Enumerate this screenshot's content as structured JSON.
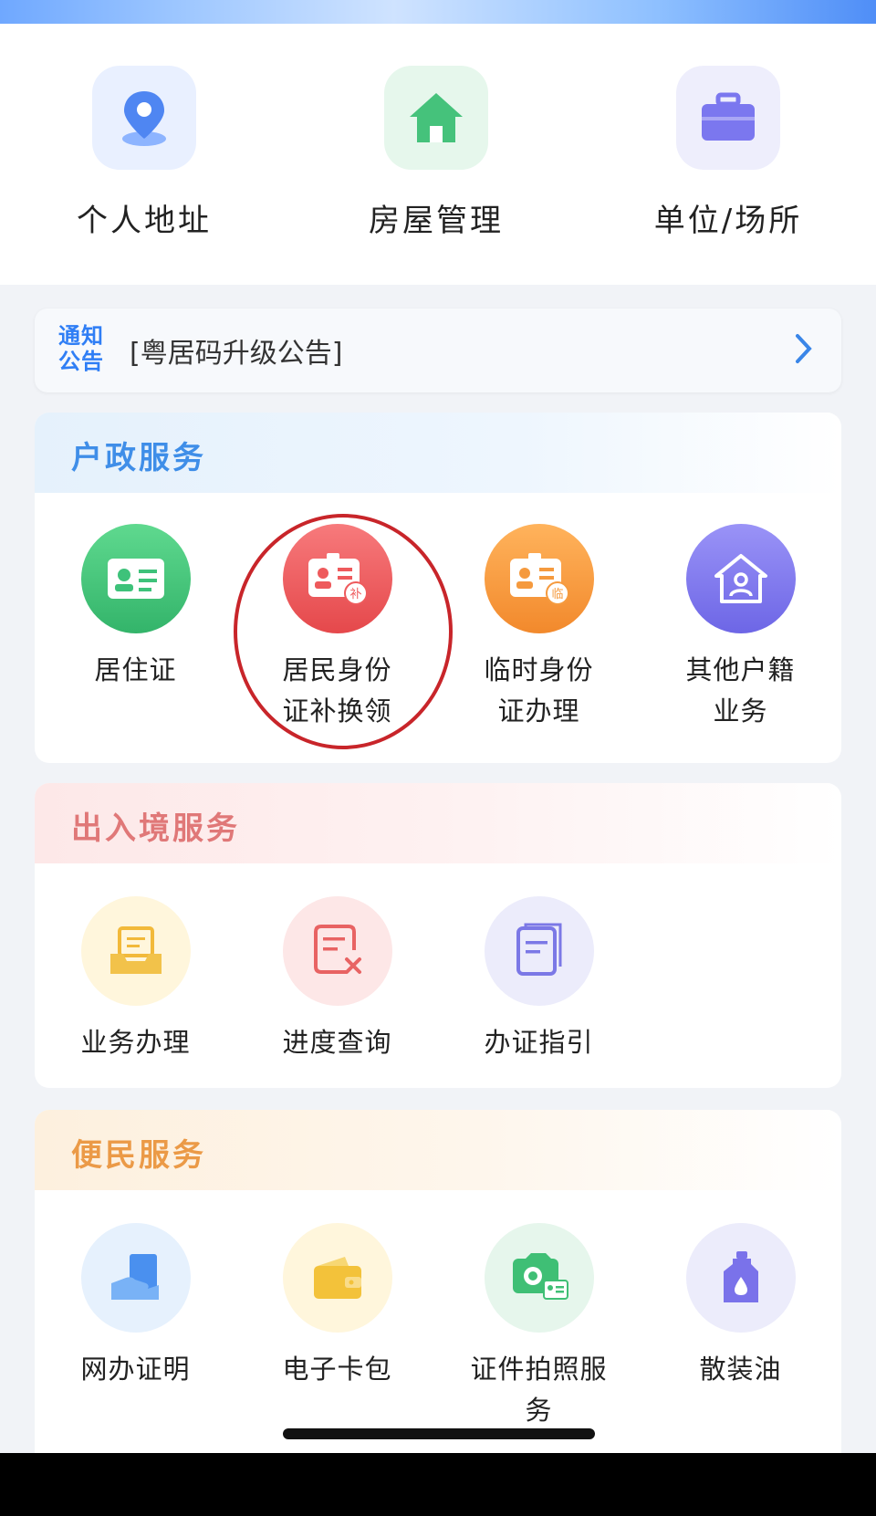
{
  "quick_actions": [
    {
      "label": "个人地址",
      "icon": "location-pin-icon",
      "color": "#5b8ef7"
    },
    {
      "label": "房屋管理",
      "icon": "house-icon",
      "color": "#43c27a"
    },
    {
      "label": "单位/场所",
      "icon": "briefcase-icon",
      "color": "#7b77ef"
    }
  ],
  "notice": {
    "badge_line1": "通知",
    "badge_line2": "公告",
    "text": "[粤居码升级公告]"
  },
  "sections": {
    "household": {
      "title": "户政服务",
      "title_color": "#3f8ee8",
      "items": [
        {
          "label_line1": "居住证",
          "label_line2": "",
          "icon": "residence-card-icon",
          "color": "#3ec27a"
        },
        {
          "label_line1": "居民身份",
          "label_line2": "证补换领",
          "icon": "id-card-replace-icon",
          "color": "#ee5a5c",
          "badge": "补"
        },
        {
          "label_line1": "临时身份",
          "label_line2": "证办理",
          "icon": "temporary-id-icon",
          "color": "#f59a3e",
          "badge": "临"
        },
        {
          "label_line1": "其他户籍",
          "label_line2": "业务",
          "icon": "household-register-icon",
          "color": "#7a73ec"
        }
      ]
    },
    "exit_entry": {
      "title": "出入境服务",
      "title_color": "#e07878",
      "items": [
        {
          "label_line1": "业务办理",
          "icon": "inbox-tray-icon",
          "color": "#f2c24a"
        },
        {
          "label_line1": "进度查询",
          "icon": "document-cancel-icon",
          "color": "#ef6b6b"
        },
        {
          "label_line1": "办证指引",
          "icon": "document-guide-icon",
          "color": "#7b78e6"
        }
      ]
    },
    "convenience": {
      "title": "便民服务",
      "title_color": "#eb9a47",
      "items": [
        {
          "label_line1": "网办证明",
          "label_line2": "",
          "icon": "hand-document-icon",
          "color": "#4a90ef"
        },
        {
          "label_line1": "电子卡包",
          "label_line2": "",
          "icon": "wallet-icon",
          "color": "#f3c23a"
        },
        {
          "label_line1": "证件拍照服",
          "label_line2": "务",
          "icon": "camera-id-icon",
          "color": "#3fbf75"
        },
        {
          "label_line1": "散装油",
          "label_line2": "",
          "icon": "oil-bottle-icon",
          "color": "#7a72ea"
        }
      ]
    }
  }
}
